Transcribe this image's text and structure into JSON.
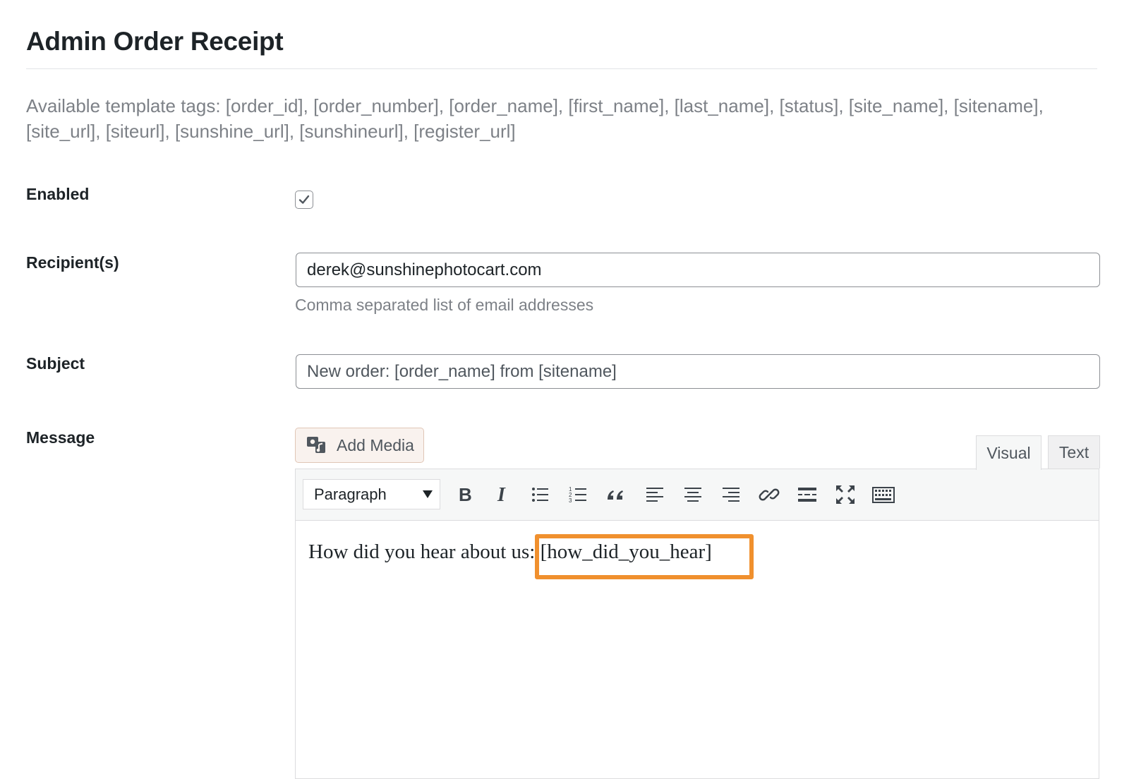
{
  "page": {
    "title": "Admin Order Receipt",
    "tags_description": "Available template tags: [order_id], [order_number], [order_name], [first_name], [last_name], [status], [site_name], [sitename], [site_url], [siteurl], [sunshine_url], [sunshineurl], [register_url]"
  },
  "fields": {
    "enabled": {
      "label": "Enabled",
      "checked": true
    },
    "recipients": {
      "label": "Recipient(s)",
      "value": "derek@sunshinephotocart.com",
      "help": "Comma separated list of email addresses"
    },
    "subject": {
      "label": "Subject",
      "value": "New order: [order_name] from [sitename]"
    },
    "message": {
      "label": "Message"
    }
  },
  "editor": {
    "add_media_label": "Add Media",
    "tabs": {
      "visual": "Visual",
      "text": "Text",
      "active": "visual"
    },
    "format_select": "Paragraph",
    "toolbar_icons": [
      "bold-icon",
      "italic-icon",
      "bullet-list-icon",
      "numbered-list-icon",
      "blockquote-icon",
      "align-left-icon",
      "align-center-icon",
      "align-right-icon",
      "link-icon",
      "read-more-icon",
      "fullscreen-icon",
      "toolbar-toggle-icon"
    ],
    "content": "How did you hear about us: [how_did_you_hear]"
  },
  "colors": {
    "highlight": "#f0902e",
    "add_media_bg": "#f9f2ee",
    "help_text": "#7d8187"
  }
}
